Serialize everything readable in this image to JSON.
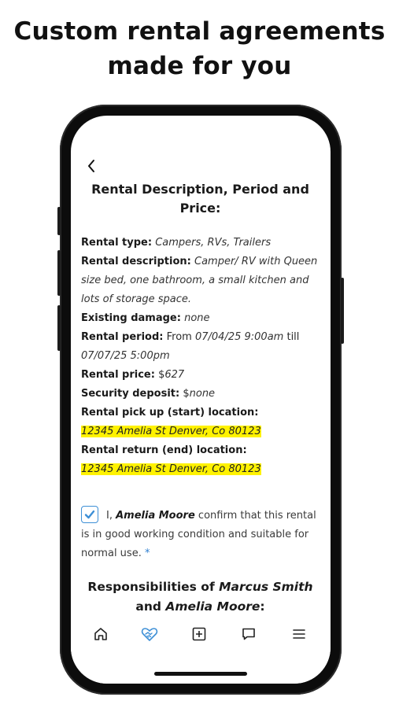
{
  "headline": {
    "line1": "Custom rental agreements",
    "line2": "made for you"
  },
  "header": {
    "back_icon": "chevron-left-icon"
  },
  "section": {
    "title": "Rental Description, Period and Price:"
  },
  "details": {
    "rental_type_label": "Rental type:",
    "rental_type_value": "Campers, RVs, Trailers",
    "rental_description_label": "Rental description:",
    "rental_description_value": "Camper/ RV with Queen size bed, one bathroom, a small kitchen and lots of storage space.",
    "existing_damage_label": "Existing damage:",
    "existing_damage_value": "none",
    "rental_period_label": "Rental period:",
    "rental_period_from": "From",
    "rental_period_start": "07/04/25 9:00am",
    "rental_period_till": "till",
    "rental_period_end": "07/07/25 5:00pm",
    "rental_price_label": "Rental price:",
    "rental_price_currency": "$",
    "rental_price_value": "627",
    "security_deposit_label": "Security deposit:",
    "security_deposit_currency": "$",
    "security_deposit_value": "none",
    "pickup_label": "Rental pick up (start) location:",
    "pickup_value": "12345 Amelia St Denver, Co 80123",
    "return_label": "Rental return (end) location:",
    "return_value": "12345 Amelia St Denver, Co 80123"
  },
  "confirmation": {
    "checked": true,
    "prefix": "I,",
    "name": "Amelia Moore",
    "text": "confirm that this rental is in good working condition and suitable for normal use.",
    "required_mark": "*"
  },
  "responsibilities": {
    "prefix": "Responsibilities of",
    "party1": "Marcus Smith",
    "and": "and",
    "party2": "Amelia Moore",
    "suffix": ":"
  },
  "tabbar": {
    "items": [
      {
        "icon": "home-icon",
        "active": false
      },
      {
        "icon": "handshake-heart-icon",
        "active": true
      },
      {
        "icon": "plus-square-icon",
        "active": false
      },
      {
        "icon": "chat-bubble-icon",
        "active": false
      },
      {
        "icon": "menu-icon",
        "active": false
      }
    ]
  },
  "colors": {
    "accent": "#3d8fd6",
    "highlight": "#fff200",
    "text": "#1a1a1a"
  }
}
